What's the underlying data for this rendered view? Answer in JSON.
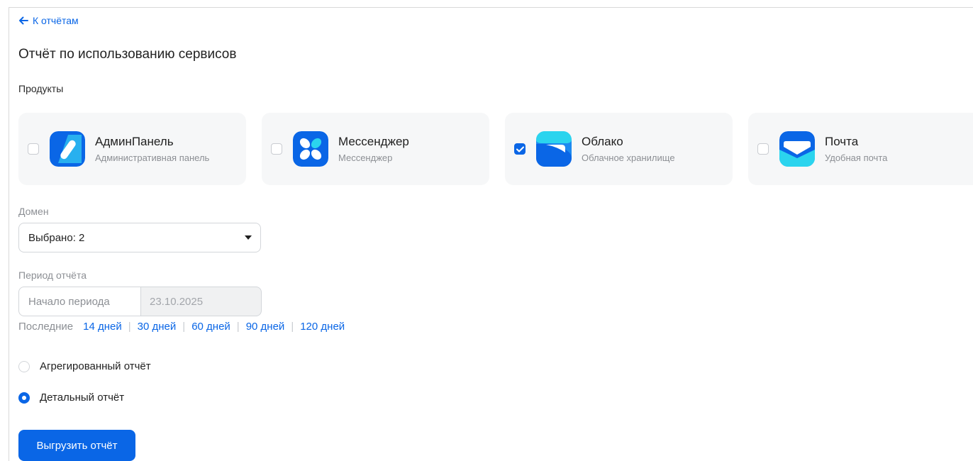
{
  "nav": {
    "back_label": "К отчётам"
  },
  "page": {
    "title": "Отчёт по использованию сервисов"
  },
  "products": {
    "label": "Продукты",
    "items": [
      {
        "name": "АдминПанель",
        "description": "Административная панель",
        "checked": false,
        "icon": "admin-panel-icon"
      },
      {
        "name": "Мессенджер",
        "description": "Мессенджер",
        "checked": false,
        "icon": "messenger-icon"
      },
      {
        "name": "Облако",
        "description": "Облачное хранилище",
        "checked": true,
        "icon": "cloud-icon"
      },
      {
        "name": "Почта",
        "description": "Удобная почта",
        "checked": false,
        "icon": "mail-icon"
      }
    ]
  },
  "domain": {
    "label": "Домен",
    "value": "Выбрано: 2"
  },
  "period": {
    "label": "Период отчёта",
    "start_placeholder": "Начало периода",
    "end_value": "23.10.2025",
    "quick_prefix": "Последние",
    "quick_options": [
      "14 дней",
      "30 дней",
      "60 дней",
      "90 дней",
      "120 дней"
    ]
  },
  "report_type": {
    "options": [
      {
        "label": "Агрегированный отчёт",
        "selected": false
      },
      {
        "label": "Детальный отчёт",
        "selected": true
      }
    ]
  },
  "actions": {
    "export_label": "Выгрузить отчёт"
  },
  "colors": {
    "accent": "#0a66e6",
    "card_bg": "#f6f7f8",
    "muted_text": "#8c8f94"
  }
}
